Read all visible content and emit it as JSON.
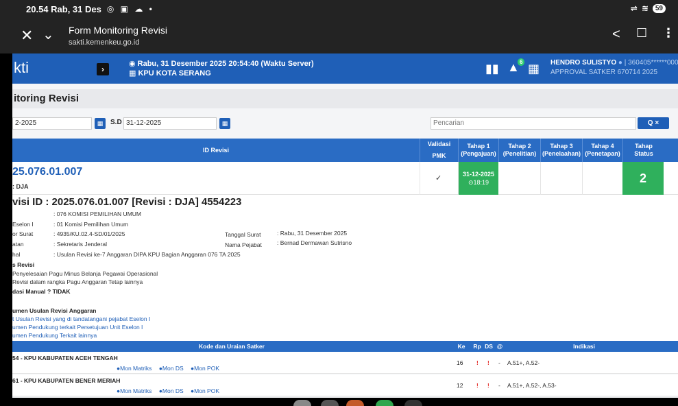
{
  "status_bar": {
    "time_date": "20.54 Rab, 31 Des",
    "battery": "59"
  },
  "browser": {
    "title": "Form Monitoring Revisi",
    "url": "sakti.kemenkeu.go.id"
  },
  "app_header": {
    "brand": "kti",
    "server_time": "Rabu, 31 Desember 2025 20:54:40 (Waktu Server)",
    "office": "KPU KOTA SERANG",
    "notif_count": "6",
    "user_name": "HENDRO SULISTYO",
    "user_nip": "| 360405******0002",
    "user_role": "APPROVAL SATKER 670714 2025"
  },
  "page_title": "itoring Revisi",
  "filters": {
    "date_from": "2-2025",
    "sd_label": "S.D",
    "date_to": "31-12-2025",
    "search_placeholder": "Pencarian",
    "search_btn": "Q  ×"
  },
  "table_headers": {
    "id_revisi": "ID Revisi",
    "validasi": "Validasi",
    "pmk": "PMK",
    "tahap1": "Tahap 1",
    "tahap1_sub": "(Pengajuan)",
    "tahap2": "Tahap 2",
    "tahap2_sub": "(Penelitian)",
    "tahap3": "Tahap 3",
    "tahap3_sub": "(Penelaahan)",
    "tahap4": "Tahap 4",
    "tahap4_sub": "(Penetapan)",
    "tahap_status": "Tahap",
    "tahap_status_sub": "Status"
  },
  "revisi_row": {
    "id": "25.076.01.007",
    "jenis": ": DJA",
    "validasi_mark": "✓",
    "tahap1_date": "31-12-2025",
    "tahap1_time": "⊙18:19",
    "status": "2"
  },
  "detail": {
    "title": "visi ID : 2025.076.01.007 [Revisi : DJA] 4554223",
    "kementerian": ": 076 KOMISI PEMILIHAN UMUM",
    "eselon_label": "Eselon I",
    "eselon": ": 01 Komisi Pemilihan Umum",
    "surat_label": "or Surat",
    "surat": ": 4935/KU.02.4-SD/01/2025",
    "tanggal_label": "Tanggal Surat",
    "tanggal": ": Rabu, 31 Desember 2025",
    "jabatan_label": "atan",
    "jabatan": ": Sekretaris Jenderal",
    "pejabat_label": "Nama Pejabat",
    "pejabat": ": Bernad Dermawan Sutrisno",
    "hal_label": "hal",
    "hal": ": Usulan Revisi ke-7 Anggaran DIPA KPU Bagian Anggaran 076 TA 2025",
    "jenis_revisi_label": "s Revisi",
    "jenis_revisi_1": "Penyelesaian Pagu Minus Belanja Pegawai Operasional",
    "jenis_revisi_2": "Revisi dalam rangka Pagu Anggaran Tetap lainnya",
    "validasi_manual": "dasi Manual ? TIDAK",
    "dokumen_label": "umen Usulan Revisi Anggaran",
    "dokumen_1": "t Usulan Revisi yang di tandatangani pejabat Eselon I",
    "dokumen_2": "umen Pendukung terkait Persetujuan Unit Eselon I",
    "dokumen_3": "umen Pendukung Terkait lainnya"
  },
  "satker_headers": {
    "kode": "Kode dan Uraian Satker",
    "ke": "Ke",
    "rp": "Rp",
    "ds": "DS",
    "at": "@",
    "indikasi": "Indikasi"
  },
  "satker_links": {
    "matriks": "●Mon Matriks",
    "ds": "●Mon DS",
    "pok": "●Mon POK"
  },
  "satker_rows": [
    {
      "name": "54 - KPU KABUPATEN ACEH TENGAH",
      "ke": "16",
      "rp": "!",
      "ds": "!",
      "at": "-",
      "indikasi": "A.51+, A.52-"
    },
    {
      "name": "61 - KPU KABUPATEN BENER MERIAH",
      "ke": "12",
      "rp": "!",
      "ds": "!",
      "at": "-",
      "indikasi": "A.51+, A.52-, A.53-"
    }
  ],
  "colors": {
    "primary": "#1f5fb7",
    "header_blue": "#2a6cc4",
    "success": "#2fb05c",
    "warning": "#e53935"
  }
}
